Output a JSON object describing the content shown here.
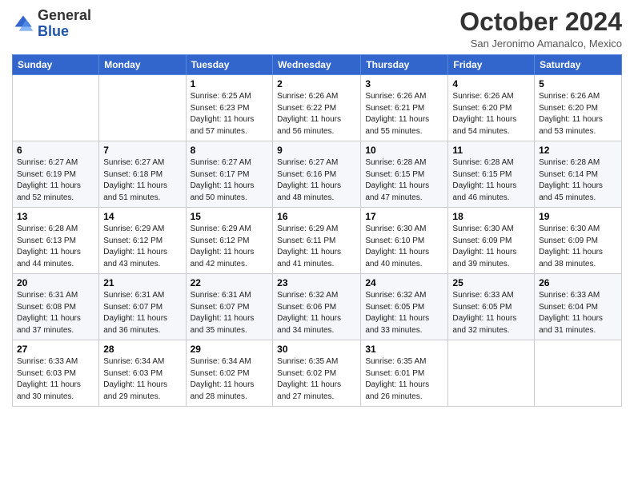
{
  "header": {
    "logo_line1": "General",
    "logo_line2": "Blue",
    "month_title": "October 2024",
    "location": "San Jeronimo Amanalco, Mexico"
  },
  "weekdays": [
    "Sunday",
    "Monday",
    "Tuesday",
    "Wednesday",
    "Thursday",
    "Friday",
    "Saturday"
  ],
  "weeks": [
    [
      {
        "day": "",
        "info": ""
      },
      {
        "day": "",
        "info": ""
      },
      {
        "day": "1",
        "info": "Sunrise: 6:25 AM\nSunset: 6:23 PM\nDaylight: 11 hours and 57 minutes."
      },
      {
        "day": "2",
        "info": "Sunrise: 6:26 AM\nSunset: 6:22 PM\nDaylight: 11 hours and 56 minutes."
      },
      {
        "day": "3",
        "info": "Sunrise: 6:26 AM\nSunset: 6:21 PM\nDaylight: 11 hours and 55 minutes."
      },
      {
        "day": "4",
        "info": "Sunrise: 6:26 AM\nSunset: 6:20 PM\nDaylight: 11 hours and 54 minutes."
      },
      {
        "day": "5",
        "info": "Sunrise: 6:26 AM\nSunset: 6:20 PM\nDaylight: 11 hours and 53 minutes."
      }
    ],
    [
      {
        "day": "6",
        "info": "Sunrise: 6:27 AM\nSunset: 6:19 PM\nDaylight: 11 hours and 52 minutes."
      },
      {
        "day": "7",
        "info": "Sunrise: 6:27 AM\nSunset: 6:18 PM\nDaylight: 11 hours and 51 minutes."
      },
      {
        "day": "8",
        "info": "Sunrise: 6:27 AM\nSunset: 6:17 PM\nDaylight: 11 hours and 50 minutes."
      },
      {
        "day": "9",
        "info": "Sunrise: 6:27 AM\nSunset: 6:16 PM\nDaylight: 11 hours and 48 minutes."
      },
      {
        "day": "10",
        "info": "Sunrise: 6:28 AM\nSunset: 6:15 PM\nDaylight: 11 hours and 47 minutes."
      },
      {
        "day": "11",
        "info": "Sunrise: 6:28 AM\nSunset: 6:15 PM\nDaylight: 11 hours and 46 minutes."
      },
      {
        "day": "12",
        "info": "Sunrise: 6:28 AM\nSunset: 6:14 PM\nDaylight: 11 hours and 45 minutes."
      }
    ],
    [
      {
        "day": "13",
        "info": "Sunrise: 6:28 AM\nSunset: 6:13 PM\nDaylight: 11 hours and 44 minutes."
      },
      {
        "day": "14",
        "info": "Sunrise: 6:29 AM\nSunset: 6:12 PM\nDaylight: 11 hours and 43 minutes."
      },
      {
        "day": "15",
        "info": "Sunrise: 6:29 AM\nSunset: 6:12 PM\nDaylight: 11 hours and 42 minutes."
      },
      {
        "day": "16",
        "info": "Sunrise: 6:29 AM\nSunset: 6:11 PM\nDaylight: 11 hours and 41 minutes."
      },
      {
        "day": "17",
        "info": "Sunrise: 6:30 AM\nSunset: 6:10 PM\nDaylight: 11 hours and 40 minutes."
      },
      {
        "day": "18",
        "info": "Sunrise: 6:30 AM\nSunset: 6:09 PM\nDaylight: 11 hours and 39 minutes."
      },
      {
        "day": "19",
        "info": "Sunrise: 6:30 AM\nSunset: 6:09 PM\nDaylight: 11 hours and 38 minutes."
      }
    ],
    [
      {
        "day": "20",
        "info": "Sunrise: 6:31 AM\nSunset: 6:08 PM\nDaylight: 11 hours and 37 minutes."
      },
      {
        "day": "21",
        "info": "Sunrise: 6:31 AM\nSunset: 6:07 PM\nDaylight: 11 hours and 36 minutes."
      },
      {
        "day": "22",
        "info": "Sunrise: 6:31 AM\nSunset: 6:07 PM\nDaylight: 11 hours and 35 minutes."
      },
      {
        "day": "23",
        "info": "Sunrise: 6:32 AM\nSunset: 6:06 PM\nDaylight: 11 hours and 34 minutes."
      },
      {
        "day": "24",
        "info": "Sunrise: 6:32 AM\nSunset: 6:05 PM\nDaylight: 11 hours and 33 minutes."
      },
      {
        "day": "25",
        "info": "Sunrise: 6:33 AM\nSunset: 6:05 PM\nDaylight: 11 hours and 32 minutes."
      },
      {
        "day": "26",
        "info": "Sunrise: 6:33 AM\nSunset: 6:04 PM\nDaylight: 11 hours and 31 minutes."
      }
    ],
    [
      {
        "day": "27",
        "info": "Sunrise: 6:33 AM\nSunset: 6:03 PM\nDaylight: 11 hours and 30 minutes."
      },
      {
        "day": "28",
        "info": "Sunrise: 6:34 AM\nSunset: 6:03 PM\nDaylight: 11 hours and 29 minutes."
      },
      {
        "day": "29",
        "info": "Sunrise: 6:34 AM\nSunset: 6:02 PM\nDaylight: 11 hours and 28 minutes."
      },
      {
        "day": "30",
        "info": "Sunrise: 6:35 AM\nSunset: 6:02 PM\nDaylight: 11 hours and 27 minutes."
      },
      {
        "day": "31",
        "info": "Sunrise: 6:35 AM\nSunset: 6:01 PM\nDaylight: 11 hours and 26 minutes."
      },
      {
        "day": "",
        "info": ""
      },
      {
        "day": "",
        "info": ""
      }
    ]
  ]
}
